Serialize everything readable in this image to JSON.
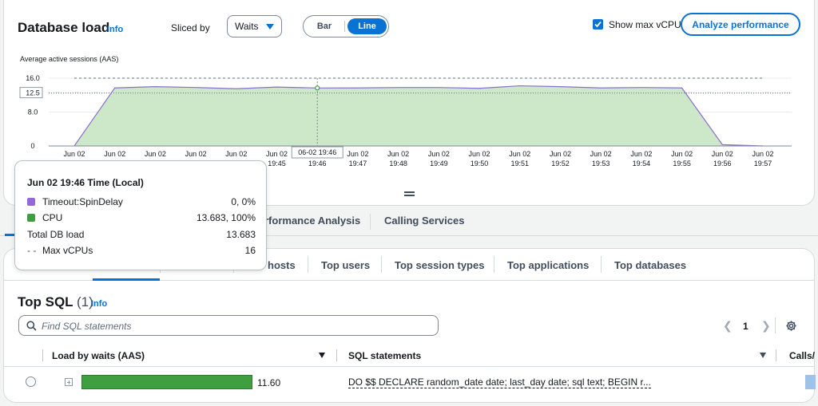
{
  "load_panel": {
    "title": "Database load",
    "info": "Info",
    "sliced_by_label": "Sliced by",
    "sliced_by_value": "Waits",
    "view_bar": "Bar",
    "view_line": "Line",
    "view_selected": "Line",
    "show_max_vcpu_label": "Show max vCPU",
    "show_max_vcpu_checked": true,
    "analyze_button": "Analyze performance"
  },
  "chart_data": {
    "type": "area",
    "ylabel": "Average active sessions (AAS)",
    "ylim": [
      0,
      16.0
    ],
    "y_ticks": [
      "0",
      "8.0",
      "12.5",
      "16.0"
    ],
    "x_ticks": [
      {
        "date": "Jun 02",
        "time": ""
      },
      {
        "date": "Jun 02",
        "time": ""
      },
      {
        "date": "Jun 02",
        "time": ""
      },
      {
        "date": "Jun 02",
        "time": ""
      },
      {
        "date": "Jun 02",
        "time": ""
      },
      {
        "date": "Jun 02",
        "time": "19:45"
      },
      {
        "date": "",
        "time": "19:46"
      },
      {
        "date": "Jun 02",
        "time": "19:47"
      },
      {
        "date": "Jun 02",
        "time": "19:48"
      },
      {
        "date": "Jun 02",
        "time": "19:49"
      },
      {
        "date": "Jun 02",
        "time": "19:50"
      },
      {
        "date": "Jun 02",
        "time": "19:51"
      },
      {
        "date": "Jun 02",
        "time": "19:52"
      },
      {
        "date": "Jun 02",
        "time": "19:53"
      },
      {
        "date": "Jun 02",
        "time": "19:54"
      },
      {
        "date": "Jun 02",
        "time": "19:55"
      },
      {
        "date": "Jun 02",
        "time": "19:56"
      },
      {
        "date": "Jun 02",
        "time": "19:57"
      }
    ],
    "series": [
      {
        "name": "CPU",
        "color": "#3f9e3f",
        "fill": "#cde8c9",
        "values": [
          0,
          13.7,
          14.0,
          13.8,
          13.5,
          13.9,
          13.683,
          13.7,
          13.8,
          13.8,
          13.6,
          14.2,
          14.0,
          13.7,
          13.8,
          13.7,
          0.3,
          0.0
        ]
      },
      {
        "name": "Timeout:SpinDelay",
        "color": "#9469d6",
        "values": [
          0,
          0,
          0,
          0,
          0,
          0,
          0,
          0,
          0,
          0,
          0,
          0,
          0,
          0,
          0,
          0,
          0,
          0
        ]
      }
    ],
    "max_vcpu": 16,
    "reference_line": 12.5,
    "hover_index": 6,
    "hover_label": "06-02 19:46",
    "grid": true
  },
  "tooltip": {
    "title": "Jun 02 19:46 Time (Local)",
    "rows": [
      {
        "label": "Timeout:SpinDelay",
        "value": "0, 0%",
        "color": "#9469d6"
      },
      {
        "label": "CPU",
        "value": "13.683, 100%",
        "color": "#3f9e3f"
      },
      {
        "label": "Total DB load",
        "value": "13.683"
      },
      {
        "label": "Max vCPUs",
        "value": "16",
        "marker": "- -"
      }
    ]
  },
  "main_tabs": [
    "rformance Analysis",
    "Calling Services"
  ],
  "dimension_tabs": [
    "hosts",
    "Top users",
    "Top session types",
    "Top applications",
    "Top databases"
  ],
  "top_sql": {
    "title": "Top SQL",
    "count": "(1)",
    "info": "Info",
    "search_placeholder": "Find SQL statements",
    "page": "1",
    "columns": [
      "Load by waits (AAS)",
      "SQL statements",
      "Calls/"
    ],
    "rows": [
      {
        "load": 11.6,
        "load_label": "11.60",
        "sql": "DO $$ DECLARE random_date date; last_day date; sql text; BEGIN r..."
      }
    ]
  },
  "colors": {
    "accent": "#0972d3",
    "cpu": "#3f9e3f",
    "spin_delay": "#9469d6"
  }
}
